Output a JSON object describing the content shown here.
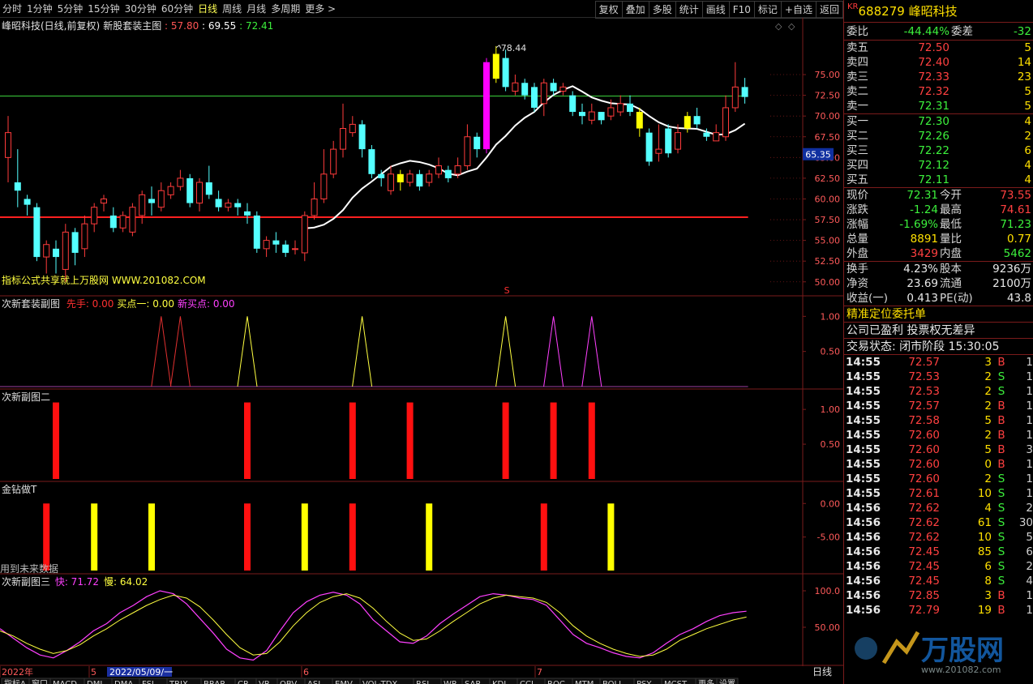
{
  "toolbar": {
    "periods": [
      "分时",
      "1分钟",
      "5分钟",
      "15分钟",
      "30分钟",
      "60分钟",
      "日线",
      "周线",
      "月线",
      "多周期",
      "更多 >"
    ],
    "active_period": "日线",
    "tools": [
      "复权",
      "叠加",
      "多股",
      "统计",
      "画线",
      "F10",
      "标记",
      "+自选",
      "返回"
    ]
  },
  "chart_data": [
    {
      "type": "candlestick",
      "title": "峰昭科技(日线,前复权)",
      "indicator": "新股套装主图",
      "indicator_values": [
        "57.80",
        "69.55",
        "72.41"
      ],
      "ylim": [
        49,
        79.5
      ],
      "yticks": [
        "75.00",
        "72.50",
        "70.00",
        "67.50",
        "65.00",
        "62.50",
        "60.00",
        "57.50",
        "55.00",
        "52.50",
        "50.00"
      ],
      "current_marker": "65.35",
      "peak_label": "78.44",
      "footer_text": "指标公式共享就上万股网 WWW.201082.COM",
      "s_marker": "S",
      "hline_red": 57.8,
      "hline_green": 72.41,
      "candles": [
        [
          65,
          68,
          62,
          70
        ],
        [
          62,
          61,
          59,
          66
        ],
        [
          60,
          59.3,
          58,
          60.5
        ],
        [
          59,
          53,
          52.5,
          59.5
        ],
        [
          53,
          54.5,
          51,
          55
        ],
        [
          54,
          53,
          51,
          55
        ],
        [
          51.5,
          56,
          50,
          57
        ],
        [
          56,
          53.5,
          52,
          56.5
        ],
        [
          54,
          57,
          53,
          58
        ],
        [
          57,
          59,
          56,
          59.5
        ],
        [
          59.5,
          60,
          58.5,
          60.5
        ],
        [
          58,
          56.5,
          56,
          59
        ],
        [
          56.5,
          58,
          56,
          58.5
        ],
        [
          56,
          59,
          55.5,
          59.5
        ],
        [
          58,
          60.5,
          57,
          61
        ],
        [
          60,
          59.5,
          58,
          61.5
        ],
        [
          59,
          61,
          58.5,
          62
        ],
        [
          60.5,
          61.5,
          60,
          62
        ],
        [
          61.5,
          62.5,
          61,
          63.5
        ],
        [
          62.5,
          59.5,
          59,
          63
        ],
        [
          59.5,
          62,
          58.5,
          62.5
        ],
        [
          62,
          60.5,
          60,
          64
        ],
        [
          60,
          59,
          58.5,
          61
        ],
        [
          59,
          59.5,
          58.5,
          60
        ],
        [
          59.5,
          59,
          58,
          60
        ],
        [
          58.5,
          58,
          57,
          59.5
        ],
        [
          58,
          54,
          53.5,
          58.5
        ],
        [
          54,
          55,
          53,
          55.5
        ],
        [
          55,
          54.5,
          53.5,
          56
        ],
        [
          54.5,
          53.5,
          53,
          55
        ],
        [
          54,
          54,
          53.3,
          55
        ],
        [
          53.5,
          58,
          52.5,
          58.5
        ],
        [
          58,
          60,
          57.5,
          62
        ],
        [
          60,
          63,
          59.5,
          66
        ],
        [
          63,
          66,
          62.5,
          67
        ],
        [
          66,
          68.5,
          65,
          71.5
        ],
        [
          68,
          69,
          67.5,
          70
        ],
        [
          69,
          66,
          65,
          69.5
        ],
        [
          66,
          63,
          62.5,
          66.5
        ],
        [
          63,
          62.5,
          61.5,
          63.5
        ],
        [
          61,
          63,
          60.5,
          64
        ],
        [
          63,
          62,
          61,
          63.5
        ],
        [
          62,
          63,
          61.5,
          63.5
        ],
        [
          63,
          61.5,
          61,
          63.5
        ],
        [
          62,
          63,
          61.5,
          63.5
        ],
        [
          63,
          64,
          62.5,
          65
        ],
        [
          63.5,
          62.5,
          62,
          64
        ],
        [
          63,
          64,
          62.5,
          65
        ],
        [
          64,
          67.5,
          63.5,
          69
        ],
        [
          67.5,
          66,
          65,
          68
        ],
        [
          66,
          76.5,
          65.5,
          77
        ],
        [
          74.5,
          77.5,
          74,
          78.44
        ],
        [
          77,
          73.5,
          73,
          78
        ],
        [
          73,
          74,
          72.5,
          75
        ],
        [
          74,
          72.5,
          72,
          74.5
        ],
        [
          73.5,
          71,
          70.5,
          74
        ],
        [
          71.5,
          74,
          70,
          74.5
        ],
        [
          74,
          73,
          72.5,
          74.5
        ],
        [
          73,
          73.5,
          72.5,
          74
        ],
        [
          72.5,
          70.5,
          70,
          73
        ],
        [
          70.5,
          70,
          69,
          71.5
        ],
        [
          69.5,
          70.5,
          69,
          71.5
        ],
        [
          70.5,
          69.5,
          69,
          70.5
        ],
        [
          70,
          71,
          69.5,
          72
        ],
        [
          70.5,
          71.5,
          70,
          72.5
        ],
        [
          71.5,
          70.5,
          70,
          72.5
        ],
        [
          70.5,
          68.5,
          67.5,
          71
        ],
        [
          68,
          64.5,
          64,
          68.5
        ],
        [
          65.5,
          66,
          64.5,
          69
        ],
        [
          68.5,
          65.5,
          65,
          69
        ],
        [
          66,
          68,
          65.5,
          69
        ],
        [
          68.5,
          70,
          68,
          70.5
        ],
        [
          70,
          69,
          68.5,
          71
        ],
        [
          68,
          67.5,
          67,
          68.5
        ],
        [
          67,
          68,
          67,
          69
        ],
        [
          67.5,
          71,
          67,
          72.5
        ],
        [
          71,
          73.5,
          70.5,
          76.5
        ],
        [
          73.5,
          72.3,
          71.5,
          74.6
        ]
      ],
      "yellow_candles": [
        41,
        51,
        66,
        71
      ]
    },
    {
      "type": "line",
      "title": "次新套装副图",
      "legend": [
        {
          "name": "先手",
          "value": "0.00"
        },
        {
          "name": "买点一",
          "value": "0.00"
        },
        {
          "name": "新买点",
          "value": "0.00"
        }
      ],
      "ylim": [
        0,
        1.2
      ],
      "yticks": [
        "1.00",
        "0.50"
      ],
      "spikes": [
        {
          "i": 16,
          "series": "先手"
        },
        {
          "i": 18,
          "series": "先手"
        },
        {
          "i": 25,
          "series": "买点一"
        },
        {
          "i": 37,
          "series": "买点一"
        },
        {
          "i": 52,
          "series": "买点一"
        },
        {
          "i": 57,
          "series": "新买点"
        },
        {
          "i": 61,
          "series": "新买点"
        }
      ]
    },
    {
      "type": "bar",
      "title": "次新副图二",
      "ylim": [
        0,
        1.2
      ],
      "yticks": [
        "1.00",
        "0.50"
      ],
      "bars": [
        5,
        25,
        36,
        42,
        52,
        57,
        61
      ]
    },
    {
      "type": "bar",
      "title": "金钻做T",
      "ylim": [
        -10,
        1
      ],
      "yticks": [
        "0.00",
        "-5.00"
      ],
      "bars": [
        {
          "i": 4,
          "c": "red"
        },
        {
          "i": 9,
          "c": "yellow"
        },
        {
          "i": 15,
          "c": "yellow"
        },
        {
          "i": 25,
          "c": "red"
        },
        {
          "i": 31,
          "c": "yellow"
        },
        {
          "i": 36,
          "c": "red"
        },
        {
          "i": 44,
          "c": "yellow"
        },
        {
          "i": 56,
          "c": "red"
        },
        {
          "i": 63,
          "c": "yellow"
        }
      ],
      "footer_text": "用到未来数据"
    },
    {
      "type": "line",
      "title": "次新副图三",
      "legend": [
        {
          "name": "快",
          "value": "71.72"
        },
        {
          "name": "慢",
          "value": "64.02"
        }
      ],
      "ylim": [
        0,
        120
      ],
      "yticks": [
        "100.0",
        "50.00"
      ],
      "fast": [
        48,
        35,
        22,
        12,
        8,
        18,
        30,
        45,
        55,
        70,
        80,
        92,
        100,
        96,
        82,
        62,
        42,
        20,
        8,
        5,
        18,
        45,
        70,
        85,
        94,
        98,
        94,
        82,
        60,
        45,
        30,
        28,
        38,
        55,
        68,
        80,
        92,
        96,
        94,
        90,
        88,
        80,
        60,
        40,
        28,
        22,
        15,
        10,
        8,
        15,
        28,
        40,
        48,
        58,
        66,
        70,
        72
      ],
      "slow": [
        45,
        38,
        28,
        20,
        14,
        18,
        26,
        38,
        48,
        60,
        70,
        80,
        88,
        94,
        90,
        78,
        60,
        40,
        22,
        12,
        14,
        30,
        52,
        70,
        84,
        92,
        96,
        90,
        76,
        58,
        42,
        32,
        34,
        45,
        58,
        70,
        82,
        90,
        94,
        92,
        90,
        84,
        70,
        52,
        38,
        28,
        20,
        14,
        10,
        12,
        20,
        32,
        40,
        48,
        54,
        60,
        64
      ]
    }
  ],
  "xaxis": {
    "labels": [
      "2022年",
      "5",
      "6",
      "7"
    ],
    "date_label": "2022/05/09/一",
    "right_label": "日线"
  },
  "bottom_tabs": [
    "指标A",
    "窗口",
    "MACD",
    "DMI",
    "DMA",
    "FSL",
    "TRIX",
    "BRAR",
    "CR",
    "VR",
    "OBV",
    "ASI",
    "EMV",
    "VOL-TDX",
    "RSI",
    "WR",
    "SAR",
    "KDJ",
    "CCI",
    "ROC",
    "MTM",
    "BOLL",
    "PSY",
    "MCST",
    "更多",
    "设置"
  ],
  "quote": {
    "market": "KR",
    "code": "688279",
    "name": "峰昭科技",
    "webi": {
      "label": "委比",
      "value": "-44.44%",
      "diff_label": "委差",
      "diff": "-32"
    },
    "asks": [
      {
        "label": "卖五",
        "price": "72.50",
        "vol": "5"
      },
      {
        "label": "卖四",
        "price": "72.40",
        "vol": "14"
      },
      {
        "label": "卖三",
        "price": "72.33",
        "vol": "23"
      },
      {
        "label": "卖二",
        "price": "72.32",
        "vol": "5"
      },
      {
        "label": "卖一",
        "price": "72.31",
        "vol": "5"
      }
    ],
    "bids": [
      {
        "label": "买一",
        "price": "72.30",
        "vol": "4"
      },
      {
        "label": "买二",
        "price": "72.26",
        "vol": "2"
      },
      {
        "label": "买三",
        "price": "72.22",
        "vol": "6"
      },
      {
        "label": "买四",
        "price": "72.12",
        "vol": "4"
      },
      {
        "label": "买五",
        "price": "72.11",
        "vol": "4"
      }
    ],
    "stats": [
      {
        "l1": "现价",
        "v1": "72.31",
        "c1": "grn",
        "l2": "今开",
        "v2": "73.55",
        "c2": "red"
      },
      {
        "l1": "涨跌",
        "v1": "-1.24",
        "c1": "grn",
        "l2": "最高",
        "v2": "74.61",
        "c2": "red"
      },
      {
        "l1": "涨幅",
        "v1": "-1.69%",
        "c1": "grn",
        "l2": "最低",
        "v2": "71.23",
        "c2": "grn"
      },
      {
        "l1": "总量",
        "v1": "8891",
        "c1": "yel",
        "l2": "量比",
        "v2": "0.77",
        "c2": "yel"
      },
      {
        "l1": "外盘",
        "v1": "3429",
        "c1": "red",
        "l2": "内盘",
        "v2": "5462",
        "c2": "grn"
      }
    ],
    "info": [
      {
        "l1": "换手",
        "v1": "4.23%",
        "l2": "股本",
        "v2": "9236万"
      },
      {
        "l1": "净资",
        "v1": "23.69",
        "l2": "流通",
        "v2": "2100万"
      },
      {
        "l1": "收益(一)",
        "v1": "0.413",
        "l2": "PE(动)",
        "v2": "43.8"
      }
    ],
    "banner": "精准定位委托单",
    "company_note": "公司已盈利 投票权无差异",
    "trade_status": "交易状态: 闭市阶段 15:30:05",
    "ticks": [
      {
        "t": "14:55",
        "p": "72.57",
        "v": "3",
        "s": "B",
        "n": "1"
      },
      {
        "t": "14:55",
        "p": "72.53",
        "v": "2",
        "s": "S",
        "n": "1"
      },
      {
        "t": "14:55",
        "p": "72.53",
        "v": "2",
        "s": "S",
        "n": "1"
      },
      {
        "t": "14:55",
        "p": "72.57",
        "v": "2",
        "s": "B",
        "n": "1"
      },
      {
        "t": "14:55",
        "p": "72.58",
        "v": "5",
        "s": "B",
        "n": "1"
      },
      {
        "t": "14:55",
        "p": "72.60",
        "v": "2",
        "s": "B",
        "n": "1"
      },
      {
        "t": "14:55",
        "p": "72.60",
        "v": "5",
        "s": "B",
        "n": "3"
      },
      {
        "t": "14:55",
        "p": "72.60",
        "v": "0",
        "s": "B",
        "n": "1"
      },
      {
        "t": "14:55",
        "p": "72.60",
        "v": "2",
        "s": "S",
        "n": "1"
      },
      {
        "t": "14:55",
        "p": "72.61",
        "v": "10",
        "s": "S",
        "n": "1"
      },
      {
        "t": "14:56",
        "p": "72.62",
        "v": "4",
        "s": "S",
        "n": "2"
      },
      {
        "t": "14:56",
        "p": "72.62",
        "v": "61",
        "s": "S",
        "n": "30"
      },
      {
        "t": "14:56",
        "p": "72.62",
        "v": "10",
        "s": "S",
        "n": "5"
      },
      {
        "t": "14:56",
        "p": "72.45",
        "v": "85",
        "s": "S",
        "n": "6"
      },
      {
        "t": "14:56",
        "p": "72.45",
        "v": "6",
        "s": "S",
        "n": "2"
      },
      {
        "t": "14:56",
        "p": "72.45",
        "v": "8",
        "s": "S",
        "n": "4"
      },
      {
        "t": "14:56",
        "p": "72.85",
        "v": "3",
        "s": "B",
        "n": "1"
      },
      {
        "t": "14:56",
        "p": "72.79",
        "v": "19",
        "s": "B",
        "n": "1"
      }
    ]
  },
  "colors": {
    "up": "#ff3b3b",
    "down": "#54ffff",
    "highlight": "#ff00ff",
    "yellow": "#ffff00",
    "ma": "#ffffff",
    "green_line": "#3ccf3c",
    "grid": "#7a1b1b"
  }
}
